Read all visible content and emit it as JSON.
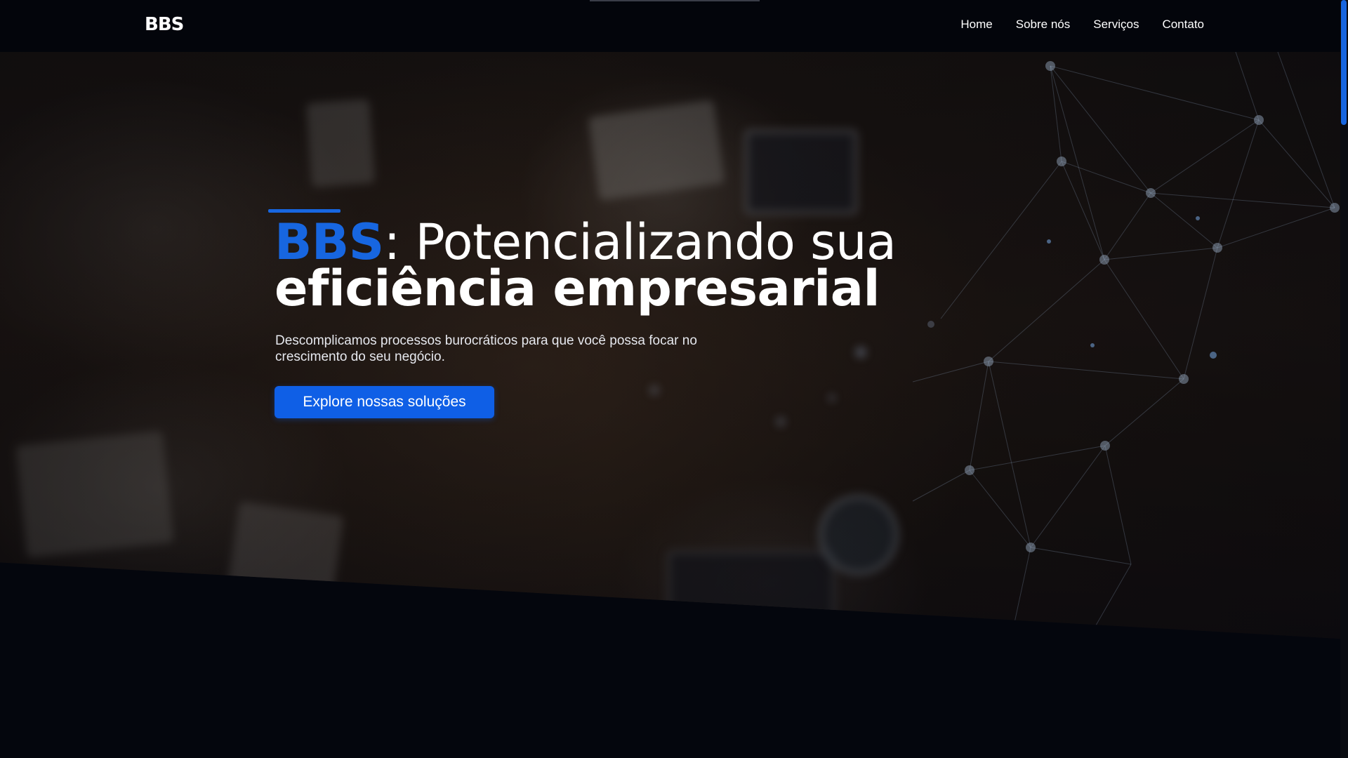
{
  "header": {
    "logo": "BBS",
    "nav": [
      {
        "label": "Home"
      },
      {
        "label": "Sobre nós"
      },
      {
        "label": "Serviços"
      },
      {
        "label": "Contato"
      }
    ]
  },
  "hero": {
    "title_brand": "BBS",
    "title_rest": ": Potencializando sua",
    "title_line2": "eficiência empresarial",
    "subtitle": "Descomplicamos processos burocráticos para que você possa focar no crescimento do seu negócio.",
    "cta_label": "Explore nossas soluções"
  },
  "colors": {
    "accent": "#1766e0",
    "button": "#0f5fe6",
    "background": "#04060d"
  },
  "icons": [
    "network-graphic"
  ]
}
